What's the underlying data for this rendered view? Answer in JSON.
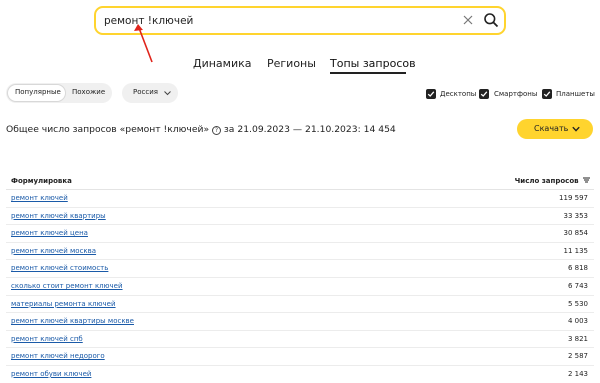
{
  "search": {
    "value": "ремонт !ключей"
  },
  "tabs": [
    {
      "label": "Динамика"
    },
    {
      "label": "Регионы"
    },
    {
      "label": "Топы запросов",
      "active": true
    }
  ],
  "filters": {
    "mode": {
      "options": [
        "Популярные",
        "Похожие"
      ],
      "selected": "Популярные"
    },
    "region": "Россия",
    "devices": [
      {
        "label": "Десктопы",
        "checked": true
      },
      {
        "label": "Смартфоны",
        "checked": true
      },
      {
        "label": "Планшеты",
        "checked": true
      }
    ]
  },
  "summary": {
    "text_before": "Общее число запросов «ремонт !ключей»",
    "help": "?",
    "text_after": "за 21.09.2023 — 21.10.2023: 14 454"
  },
  "download_label": "Скачать",
  "table": {
    "col_phrase": "Формулировка",
    "col_count": "Число запросов",
    "rows": [
      {
        "phrase": "ремонт ключей",
        "count": "119 597"
      },
      {
        "phrase": "ремонт ключей квартиры",
        "count": "33 353"
      },
      {
        "phrase": "ремонт ключей цена",
        "count": "30 854"
      },
      {
        "phrase": "ремонт ключей москва",
        "count": "11 135"
      },
      {
        "phrase": "ремонт ключей стоимость",
        "count": "6 818"
      },
      {
        "phrase": "сколько стоит ремонт ключей",
        "count": "6 743"
      },
      {
        "phrase": "материалы ремонта ключей",
        "count": "5 530"
      },
      {
        "phrase": "ремонт ключей квартиры москве",
        "count": "4 003"
      },
      {
        "phrase": "ремонт ключей спб",
        "count": "3 821"
      },
      {
        "phrase": "ремонт ключей недорого",
        "count": "2 587"
      },
      {
        "phrase": "ремонт обуви ключей",
        "count": "2 143"
      }
    ]
  },
  "colors": {
    "accent": "#ffd42e",
    "link": "#1a5aa8",
    "annotation_arrow": "#e0241b"
  }
}
